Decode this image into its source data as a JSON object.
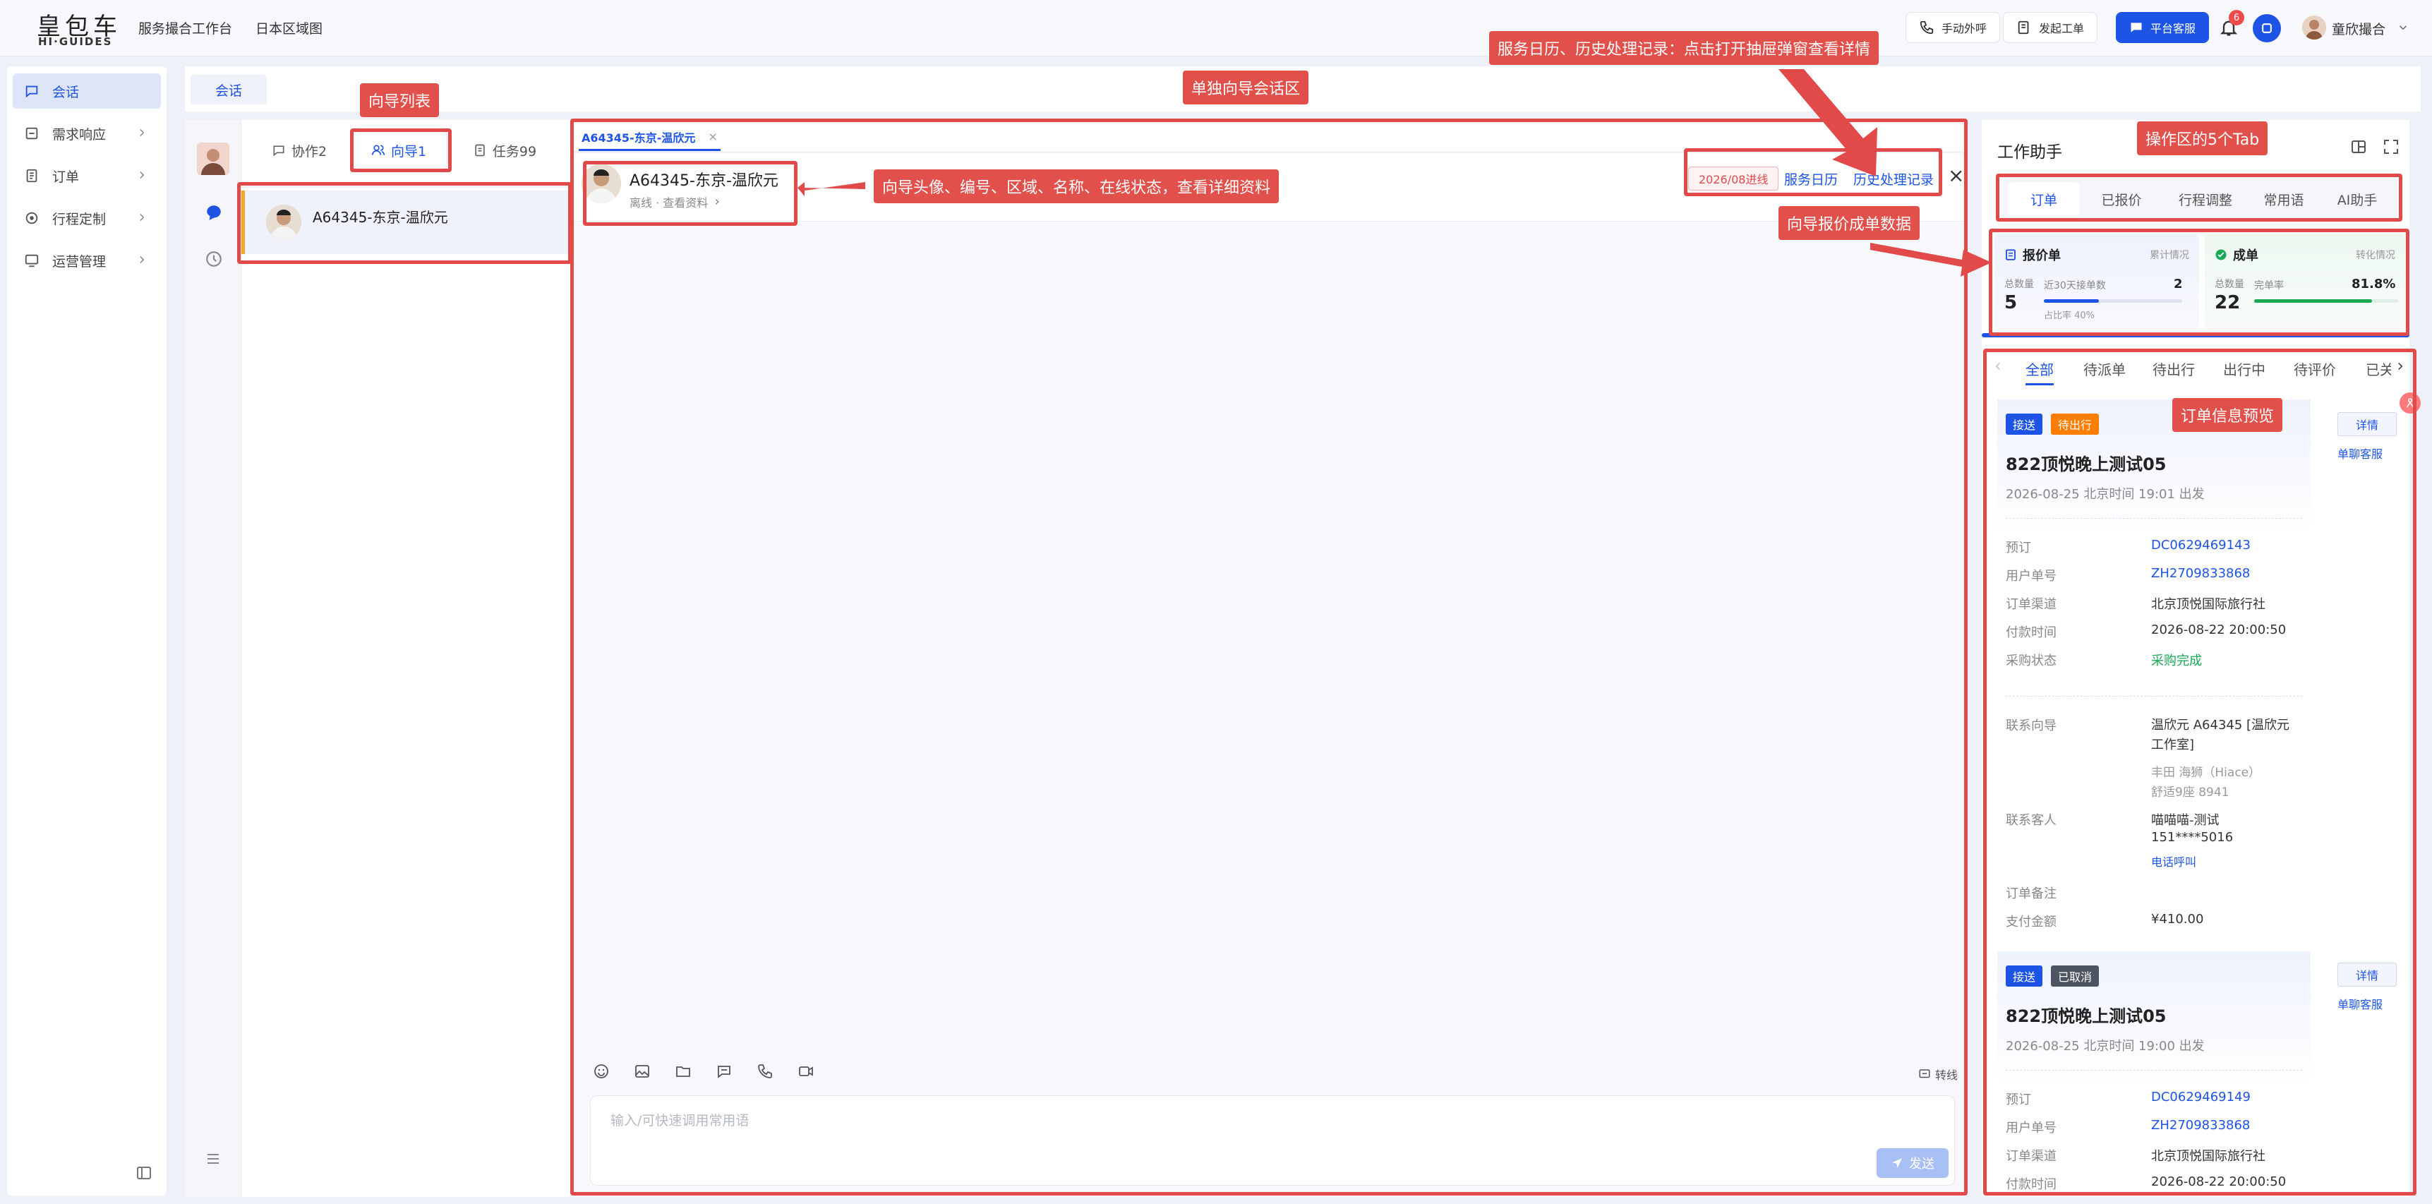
{
  "logo": {
    "cn": "皇包车",
    "en": "HI·GUIDES"
  },
  "topnav": [
    "服务撮合工作台",
    "日本区域图"
  ],
  "topbar": {
    "call_label": "手动外呼",
    "ticket_label": "发起工单",
    "platform_label": "平台客服",
    "notif_count": "6",
    "user_name": "童欣撮合"
  },
  "sidebar": {
    "items": [
      {
        "label": "会话",
        "icon": "chat-icon",
        "active": true
      },
      {
        "label": "需求响应",
        "icon": "request-icon"
      },
      {
        "label": "订单",
        "icon": "order-icon"
      },
      {
        "label": "行程定制",
        "icon": "itinerary-icon"
      },
      {
        "label": "运营管理",
        "icon": "operations-icon"
      }
    ]
  },
  "workspace": {
    "tab_label": "会话"
  },
  "list": {
    "segments": [
      {
        "label": "协作2",
        "icon": "collab-icon"
      },
      {
        "label": "向导1",
        "icon": "guides-icon",
        "active": true
      },
      {
        "label": "任务99",
        "icon": "task-icon"
      }
    ],
    "guides": [
      {
        "name": "A64345-东京-温欣元"
      }
    ]
  },
  "chat": {
    "tab_title": "A64345-东京-温欣元",
    "tab_close": "×",
    "header": {
      "name": "A64345-东京-温欣元",
      "status": "离线 · 查看资料",
      "badge": "2026/08进线",
      "link1": "服务日历",
      "link2": "历史处理记录",
      "close": "×"
    },
    "toolbar_transfer": "转线",
    "input_placeholder": "输入/可快速调用常用语",
    "send_label": "发送"
  },
  "assistant": {
    "title": "工作助手",
    "tabs": [
      "订单",
      "已报价",
      "行程调整",
      "常用语",
      "AI助手"
    ],
    "quote": {
      "title": "报价单",
      "subtitle": "累计情况",
      "total_label": "总数量",
      "total": "5",
      "recent_label": "近30天接单数",
      "recent": "2",
      "ratio": "占比率 40%",
      "ratio_value": 0.4
    },
    "deal": {
      "title": "成单",
      "subtitle": "转化情况",
      "total_label": "总数量",
      "total": "22",
      "rate_label": "完单率",
      "rate": "81.8%",
      "rate_value": 0.818
    },
    "order_tabs": [
      "全部",
      "待派单",
      "待出行",
      "出行中",
      "待评价",
      "已关"
    ],
    "orders": [
      {
        "tag1": "接送",
        "tag2": "待出行",
        "tag2_color": "#ff7d00",
        "title": "822顶悦晚上测试05",
        "time": "2026-08-25 北京时间 19:01 出发",
        "detail_btn": "详情",
        "chat_btn": "单聊客服",
        "fields": [
          {
            "label": "预订",
            "value": "DC0629469143",
            "link": true
          },
          {
            "label": "用户单号",
            "value": "ZH2709833868",
            "link": true
          },
          {
            "label": "订单渠道",
            "value": "北京顶悦国际旅行社"
          },
          {
            "label": "付款时间",
            "value": "2026-08-22 20:00:50"
          },
          {
            "label": "采购状态",
            "value": "采购完成",
            "green": true
          }
        ],
        "guide_label": "联系向导",
        "guide_value": "温欣元 A64345 [温欣元工作室]",
        "car": "丰田 海狮（Hiace）",
        "car2": "舒适9座 8941",
        "contact_label": "联系客人",
        "contact_name": "喵喵喵-测试",
        "contact_phone": "151****5016",
        "contact_call": "电话呼叫",
        "remark_label": "订单备注",
        "pay_label": "支付金额",
        "pay_value": "¥410.00"
      },
      {
        "tag1": "接送",
        "tag2": "已取消",
        "tag2_color": "#4e5562",
        "title": "822顶悦晚上测试05",
        "time": "2026-08-25 北京时间 19:00 出发",
        "detail_btn": "详情",
        "chat_btn": "单聊客服",
        "fields": [
          {
            "label": "预订",
            "value": "DC0629469149",
            "link": true
          },
          {
            "label": "用户单号",
            "value": "ZH2709833868",
            "link": true
          },
          {
            "label": "订单渠道",
            "value": "北京顶悦国际旅行社"
          },
          {
            "label": "付款时间",
            "value": "2026-08-22 20:00:50"
          }
        ]
      }
    ]
  },
  "annotations": {
    "guide_list": "向导列表",
    "chat_area": "单独向导会话区",
    "calendar_note": "服务日历、历史处理记录：点击打开抽屉弹窗查看详情",
    "ops_tabs": "操作区的5个Tab",
    "guide_info": "向导头像、编号、区域、名称、在线状态，查看详细资料",
    "quote_data": "向导报价成单数据",
    "order_preview": "订单信息预览"
  },
  "colors": {
    "primary": "#1d54e6",
    "annotation": "#e24a4a",
    "success": "#1aaa55",
    "warning": "#ff7d00"
  }
}
